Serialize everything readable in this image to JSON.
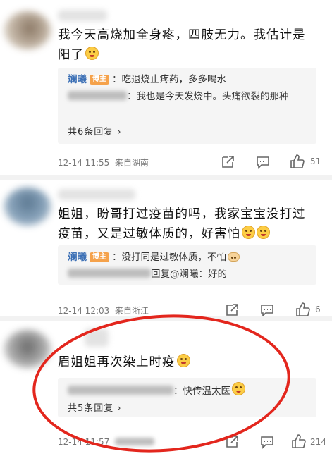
{
  "comments": [
    {
      "text": "我今天高烧加全身疼，四肢无力。我估计是阳了",
      "replies": [
        {
          "name": "斓曦",
          "badge": "博主",
          "text": "：吃退烧止疼药，多多喝水"
        },
        {
          "name": "",
          "badge": "",
          "text": "：我也是今天发烧中。头痛欲裂的那种"
        }
      ],
      "more": "共6条回复 ›",
      "time": "12-14 11:55",
      "location": "来自湖南",
      "likes": "51"
    },
    {
      "text": "姐姐，盼哥打过疫苗的吗，我家宝宝没打过疫苗，又是过敏体质的，好害怕",
      "replies": [
        {
          "name": "斓曦",
          "badge": "博主",
          "text": "：没打同是过敏体质，不怕"
        },
        {
          "name": "",
          "badge": "",
          "text": "回复@斓曦：好的"
        }
      ],
      "more": "",
      "time": "12-14 12:03",
      "location": "来自浙江",
      "likes": "6"
    },
    {
      "text": "眉姐姐再次染上时疫",
      "replies": [
        {
          "name": "",
          "badge": "",
          "text": "：快传温太医"
        }
      ],
      "more": "共5条回复 ›",
      "time": "12-14 11:57",
      "location": "",
      "likes": "214"
    }
  ],
  "icons": {
    "share": "share-icon",
    "comment": "comment-icon",
    "like": "like-icon"
  },
  "colors": {
    "highlight": "#e3261d",
    "name": "#3b6fb5",
    "badge": "#f5a24b"
  }
}
